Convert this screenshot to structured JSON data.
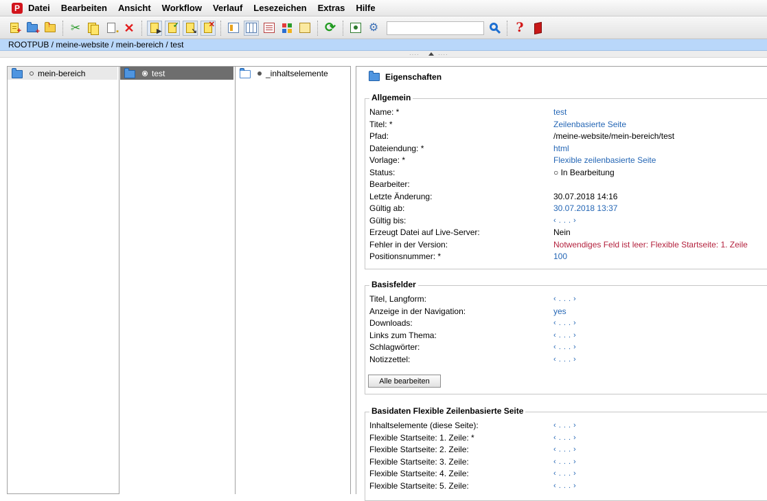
{
  "app": {
    "logo_text": "P"
  },
  "menu": [
    "Datei",
    "Bearbeiten",
    "Ansicht",
    "Workflow",
    "Verlauf",
    "Lesezeichen",
    "Extras",
    "Hilfe"
  ],
  "toolbar": {
    "search_placeholder": "",
    "icons": [
      "new-page-icon",
      "new-folder-icon",
      "upload-icon",
      "cut-icon",
      "copy-icon",
      "paste-icon",
      "delete-icon",
      "move-icon",
      "release-icon",
      "approve-icon",
      "reject-icon",
      "view-list-icon",
      "view-columns-icon",
      "view-details-icon",
      "view-tiles-icon",
      "view-preview-icon",
      "refresh-icon",
      "preview-icon",
      "settings-icon",
      "search-icon",
      "help-icon",
      "exit-icon"
    ]
  },
  "breadcrumb": "ROOTPUB / meine-website / mein-bereich / test",
  "columns": [
    {
      "label": "mein-bereich"
    },
    {
      "label": "test"
    },
    {
      "label": "_inhaltselemente"
    }
  ],
  "properties": {
    "title": "Eigenschaften",
    "allgemein": {
      "legend": "Allgemein",
      "rows": [
        {
          "label": "Name: *",
          "value": "test"
        },
        {
          "label": "Titel: *",
          "value": "Zeilenbasierte Seite"
        },
        {
          "label": "Pfad:",
          "value": "/meine-website/mein-bereich/test"
        },
        {
          "label": "Dateiendung: *",
          "value": "html"
        },
        {
          "label": "Vorlage: *",
          "value": "Flexible zeilenbasierte Seite"
        },
        {
          "label": "Status:",
          "value": "○ In Bearbeitung"
        },
        {
          "label": "Bearbeiter:",
          "value": ""
        },
        {
          "label": "Letzte Änderung:",
          "value": "30.07.2018 14:16"
        },
        {
          "label": "Gültig ab:",
          "value": "30.07.2018 13:37"
        },
        {
          "label": "Gültig bis:",
          "value": "‹ . . . ›"
        },
        {
          "label": "Erzeugt Datei auf Live-Server:",
          "value": "Nein"
        },
        {
          "label": "Fehler in der Version:",
          "value": "Notwendiges Feld ist leer: Flexible Startseite: 1. Zeile"
        },
        {
          "label": "Positionsnummer: *",
          "value": "100"
        }
      ]
    },
    "basisfelder": {
      "legend": "Basisfelder",
      "rows": [
        {
          "label": "Titel, Langform:",
          "value": "‹ . . . ›"
        },
        {
          "label": "Anzeige in der Navigation:",
          "value": "yes"
        },
        {
          "label": "Downloads:",
          "value": "‹ . . . ›"
        },
        {
          "label": "Links zum Thema:",
          "value": "‹ . . . ›"
        },
        {
          "label": "Schlagwörter:",
          "value": "‹ . . . ›"
        },
        {
          "label": "Notizzettel:",
          "value": "‹ . . . ›"
        }
      ],
      "button": "Alle bearbeiten"
    },
    "basisdaten": {
      "legend": "Basidaten Flexible Zeilenbasierte Seite",
      "rows": [
        {
          "label": "Inhaltselemente (diese Seite):",
          "value": "‹ . . . ›"
        },
        {
          "label": "Flexible Startseite: 1. Zeile: *",
          "value": "‹ . . . ›"
        },
        {
          "label": "Flexible Startseite: 2. Zeile:",
          "value": "‹ . . . ›"
        },
        {
          "label": "Flexible Startseite: 3. Zeile:",
          "value": "‹ . . . ›"
        },
        {
          "label": "Flexible Startseite: 4. Zeile:",
          "value": "‹ . . . ›"
        },
        {
          "label": "Flexible Startseite: 5. Zeile:",
          "value": "‹ . . . ›"
        }
      ]
    },
    "colors": {
      "link": "#2466b5",
      "error": "#b3203c",
      "selected_bg": "#6e6e6e",
      "breadcrumb_bg": "#b9d7fa"
    }
  }
}
